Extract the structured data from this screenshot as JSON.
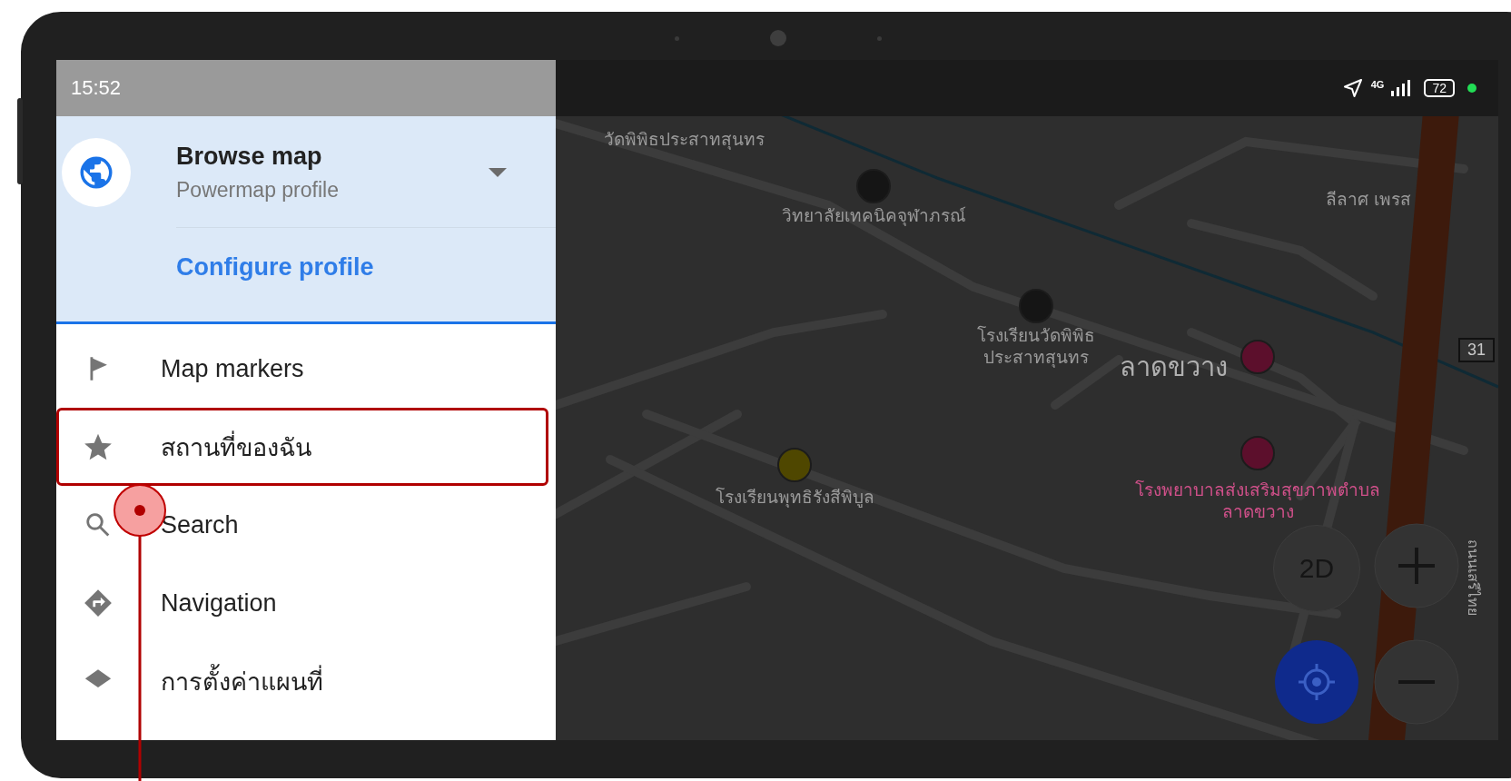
{
  "status_bar": {
    "time": "15:52",
    "network": "4G",
    "battery": "72"
  },
  "drawer": {
    "profile": {
      "title": "Browse map",
      "subtitle": "Powermap profile",
      "link": "Configure profile"
    },
    "items": [
      {
        "label": "Map markers",
        "highlighted": false
      },
      {
        "label": "สถานที่ของฉัน",
        "highlighted": true
      },
      {
        "label": "Search",
        "highlighted": false
      },
      {
        "label": "Navigation",
        "highlighted": false
      },
      {
        "label": "การตั้งค่าแผนที่",
        "highlighted": false
      }
    ]
  },
  "map": {
    "labels": [
      {
        "text": "วัดพิพิธประสาทสุนทร",
        "kind": "place"
      },
      {
        "text": "วิทยาลัยเทคนิคจุฬาภรณ์",
        "kind": "place"
      },
      {
        "text": "ลีลาศ เพรส",
        "kind": "place"
      },
      {
        "text": "โรงเรียนวัดพิพิธประสาทสุนทร",
        "kind": "place"
      },
      {
        "text": "ลาดขวาง",
        "kind": "area"
      },
      {
        "text": "โรงเรียนพุทธิรังสีพิบูล",
        "kind": "place"
      },
      {
        "text": "โรงพยาบาลส่งเสริมสุขภาพตำบลลาดขวาง",
        "kind": "hospital"
      },
      {
        "text": "31",
        "kind": "road-number"
      },
      {
        "text": "ถนนเสรีไทย",
        "kind": "road"
      }
    ],
    "pois": [
      {
        "color": "#151515"
      },
      {
        "color": "#151515"
      },
      {
        "color": "#5c0f2c"
      },
      {
        "color": "#5c0f2c"
      },
      {
        "color": "#4f4700"
      }
    ],
    "controls": {
      "mode": "2D"
    }
  }
}
